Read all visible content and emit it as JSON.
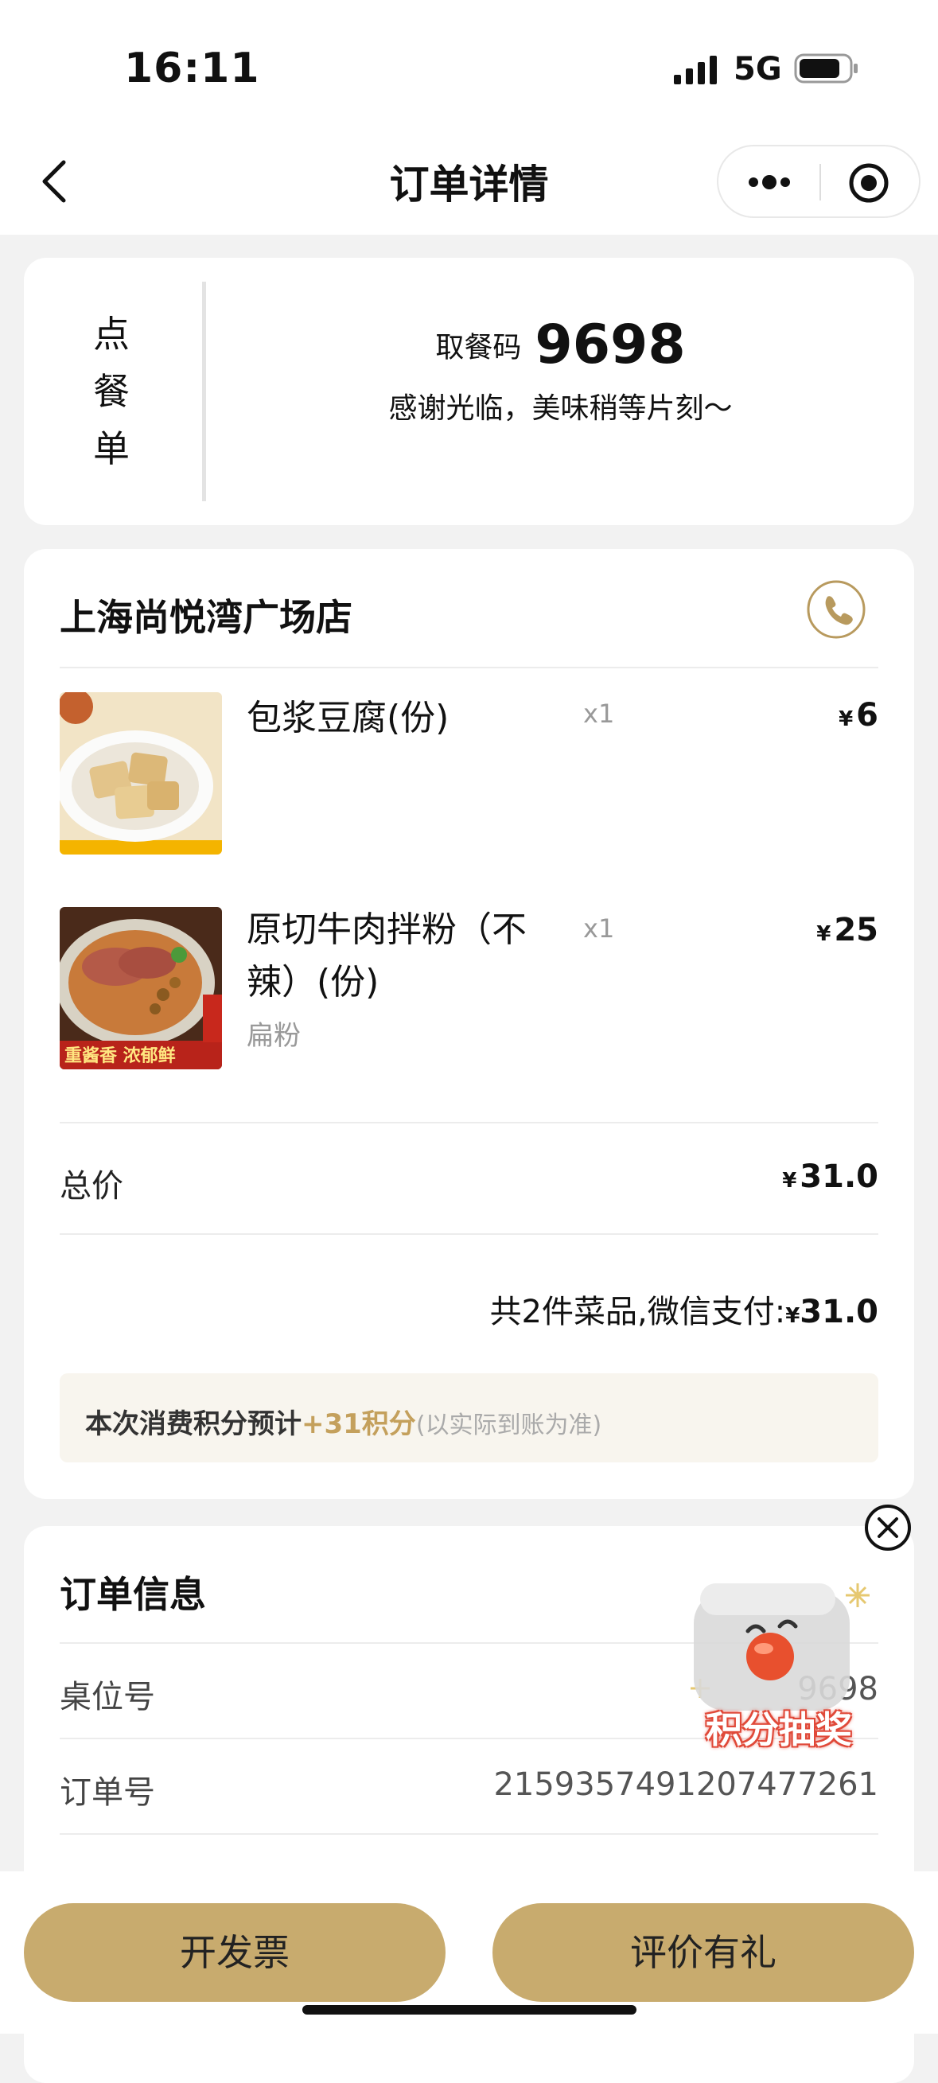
{
  "status": {
    "time": "16:11",
    "network": "5G"
  },
  "nav": {
    "title": "订单详情"
  },
  "pickup": {
    "vertical_label": [
      "点",
      "餐",
      "单"
    ],
    "code_label": "取餐码",
    "code": "9698",
    "message": "感谢光临，美味稍等片刻～"
  },
  "store": {
    "name": "上海尚悦湾广场店"
  },
  "items": [
    {
      "name": "包浆豆腐(份)",
      "qty": "x1",
      "currency": "¥",
      "price": "6",
      "spec": ""
    },
    {
      "name": "原切牛肉拌粉（不辣）(份)",
      "name_line1": "原切牛肉拌粉（不",
      "name_line2": "辣）(份)",
      "qty": "x1",
      "currency": "¥",
      "price": "25",
      "spec": "扁粉",
      "image_caption": "重酱香 浓郁鲜"
    }
  ],
  "total": {
    "label": "总价",
    "currency": "¥",
    "value": "31.0"
  },
  "payment": {
    "text": "共2件菜品,微信支付:",
    "currency": "¥",
    "value": "31.0"
  },
  "points": {
    "prefix": "本次消费积分预计",
    "amount": "+31积分",
    "note": "(以实际到账为准)"
  },
  "order_info": {
    "title": "订单信息",
    "rows": [
      {
        "label": "桌位号",
        "value": "9698"
      },
      {
        "label": "订单号",
        "value": "2159357491207477261"
      }
    ]
  },
  "lottery": {
    "label": "积分抽奖"
  },
  "buttons": {
    "invoice": "开发票",
    "review": "评价有礼"
  },
  "colors": {
    "gold": "#c8ab6e",
    "points_highlight": "#c4a05c",
    "background": "#f2f2f2"
  }
}
